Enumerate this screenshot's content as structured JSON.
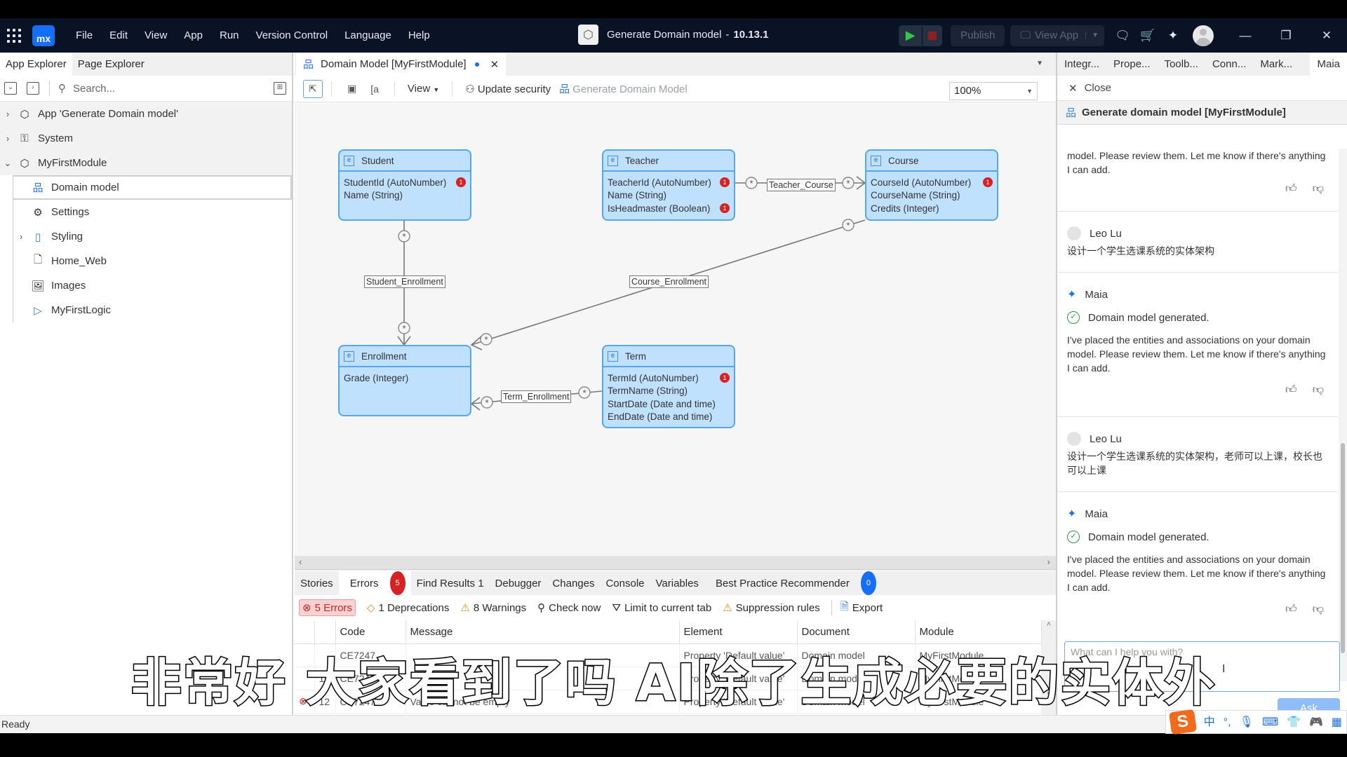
{
  "titlebar": {
    "menu": [
      "File",
      "Edit",
      "View",
      "App",
      "Run",
      "Version Control",
      "Language",
      "Help"
    ],
    "logo_text": "mx",
    "project_title": "Generate Domain model",
    "separator": "-",
    "version": "10.13.1",
    "publish_label": "Publish",
    "view_app_label": "View App",
    "icons": [
      "apps-grid-icon",
      "run-icon",
      "stop-icon",
      "chat-feedback-icon",
      "marketplace-cart-icon",
      "maia-sparkle-icon",
      "user-avatar-icon",
      "minimize-icon",
      "restore-icon",
      "close-icon"
    ]
  },
  "left_pane": {
    "tabs": [
      "App Explorer",
      "Page Explorer"
    ],
    "active_tab": "App Explorer",
    "search_placeholder": "Search...",
    "tree": [
      {
        "label": "App 'Generate Domain model'",
        "icon": "app-cube-icon",
        "expandable": true,
        "expanded": false
      },
      {
        "label": "System",
        "icon": "module-lock-icon",
        "expandable": true,
        "expanded": false
      },
      {
        "label": "MyFirstModule",
        "icon": "module-icon",
        "expandable": true,
        "expanded": true
      },
      {
        "label": "Domain model",
        "icon": "domain-model-icon",
        "selected": true
      },
      {
        "label": "Settings",
        "icon": "gear-icon"
      },
      {
        "label": "Styling",
        "icon": "styling-icon",
        "expandable": true
      },
      {
        "label": "Home_Web",
        "icon": "page-icon"
      },
      {
        "label": "Images",
        "icon": "images-icon"
      },
      {
        "label": "MyFirstLogic",
        "icon": "microflow-icon"
      }
    ]
  },
  "editor": {
    "tab_label": "Domain Model [MyFirstModule]",
    "tab_unsaved": true,
    "toolbar": {
      "view_label": "View",
      "update_security_label": "Update security",
      "generate_label": "Generate Domain Model",
      "zoom_value": "100%"
    },
    "entities": [
      {
        "name": "Student",
        "attributes": [
          {
            "text": "StudentId (AutoNumber)",
            "errors": 1
          },
          {
            "text": "Name (String)",
            "errors": 0
          }
        ]
      },
      {
        "name": "Teacher",
        "attributes": [
          {
            "text": "TeacherId (AutoNumber)",
            "errors": 1
          },
          {
            "text": "Name (String)",
            "errors": 0
          },
          {
            "text": "IsHeadmaster (Boolean)",
            "errors": 1
          }
        ]
      },
      {
        "name": "Course",
        "attributes": [
          {
            "text": "CourseId (AutoNumber)",
            "errors": 1
          },
          {
            "text": "CourseName (String)",
            "errors": 0
          },
          {
            "text": "Credits (Integer)",
            "errors": 0
          }
        ]
      },
      {
        "name": "Enrollment",
        "attributes": [
          {
            "text": "Grade (Integer)",
            "errors": 0
          }
        ]
      },
      {
        "name": "Term",
        "attributes": [
          {
            "text": "TermId (AutoNumber)",
            "errors": 1
          },
          {
            "text": "TermName (String)",
            "errors": 0
          },
          {
            "text": "StartDate (Date and time)",
            "errors": 0
          },
          {
            "text": "EndDate (Date and time)",
            "errors": 0
          }
        ]
      }
    ],
    "associations": [
      {
        "name": "Teacher_Course",
        "from": "Teacher",
        "to": "Course"
      },
      {
        "name": "Student_Enrollment",
        "from": "Student",
        "to": "Enrollment"
      },
      {
        "name": "Course_Enrollment",
        "from": "Course",
        "to": "Enrollment"
      },
      {
        "name": "Term_Enrollment",
        "from": "Term",
        "to": "Enrollment"
      }
    ]
  },
  "dock": {
    "tabs": [
      "Stories",
      "Errors",
      "Find Results 1",
      "Debugger",
      "Changes",
      "Console",
      "Variables",
      "Best Practice Recommender"
    ],
    "active_tab": "Errors",
    "errors_badge": "5",
    "bpr_badge": "0",
    "filters": {
      "errors": "5 Errors",
      "deprecations": "1 Deprecations",
      "warnings": "8 Warnings",
      "check_now": "Check now",
      "limit": "Limit to current tab",
      "suppression": "Suppression rules",
      "export": "Export"
    },
    "columns": [
      "",
      "",
      "Code",
      "Message",
      "Element",
      "Document",
      "Module"
    ],
    "rows": [
      [
        "",
        "",
        "CE7247",
        "",
        "Property 'Default value'",
        "Domain model",
        "MyFirstModule"
      ],
      [
        "",
        "11",
        "CE7247",
        "",
        "Property 'Default value'",
        "Domain model",
        "MyFirstModule"
      ],
      [
        "error",
        "12",
        "CE7247",
        "Value cannot be empty",
        "Property 'Default value'",
        "Domain model",
        "MyFirstModule"
      ]
    ],
    "colors": {
      "error": "#d62222",
      "info": "#146ff4"
    }
  },
  "right_pane": {
    "tabs": [
      "Integr...",
      "Prope...",
      "Toolb...",
      "Conn...",
      "Mark...",
      "Maia"
    ],
    "active_tab": "Maia",
    "close_label": "Close",
    "header": "Generate domain model [MyFirstModule]",
    "messages": [
      {
        "type": "maia-tail",
        "text": "model. Please review them. Let me know if there's anything I can add."
      },
      {
        "type": "user",
        "author": "Leo Lu",
        "text": "设计一个学生选课系统的实体架构"
      },
      {
        "type": "maia",
        "author": "Maia",
        "status": "Domain model generated.",
        "text": "I've placed the entities and associations on your domain model. Please review them. Let me know if there's anything I can add."
      },
      {
        "type": "user",
        "author": "Leo Lu",
        "text": "设计一个学生选课系统的实体架构，老师可以上课，校长也可以上课"
      },
      {
        "type": "maia",
        "author": "Maia",
        "status": "Domain model generated.",
        "text": "I've placed the entities and associations on your domain model. Please review them. Let me know if there's anything I can add."
      }
    ],
    "input_placeholder": "What can I help you with?",
    "ask_label": "Ask"
  },
  "status_bar": {
    "text": "Ready",
    "ime": [
      "中",
      "°,",
      "mic",
      "keyboard",
      "skin",
      "game",
      "apps"
    ]
  },
  "subtitle": "非常好 大家看到了吗 AI除了生成必要的实体外"
}
